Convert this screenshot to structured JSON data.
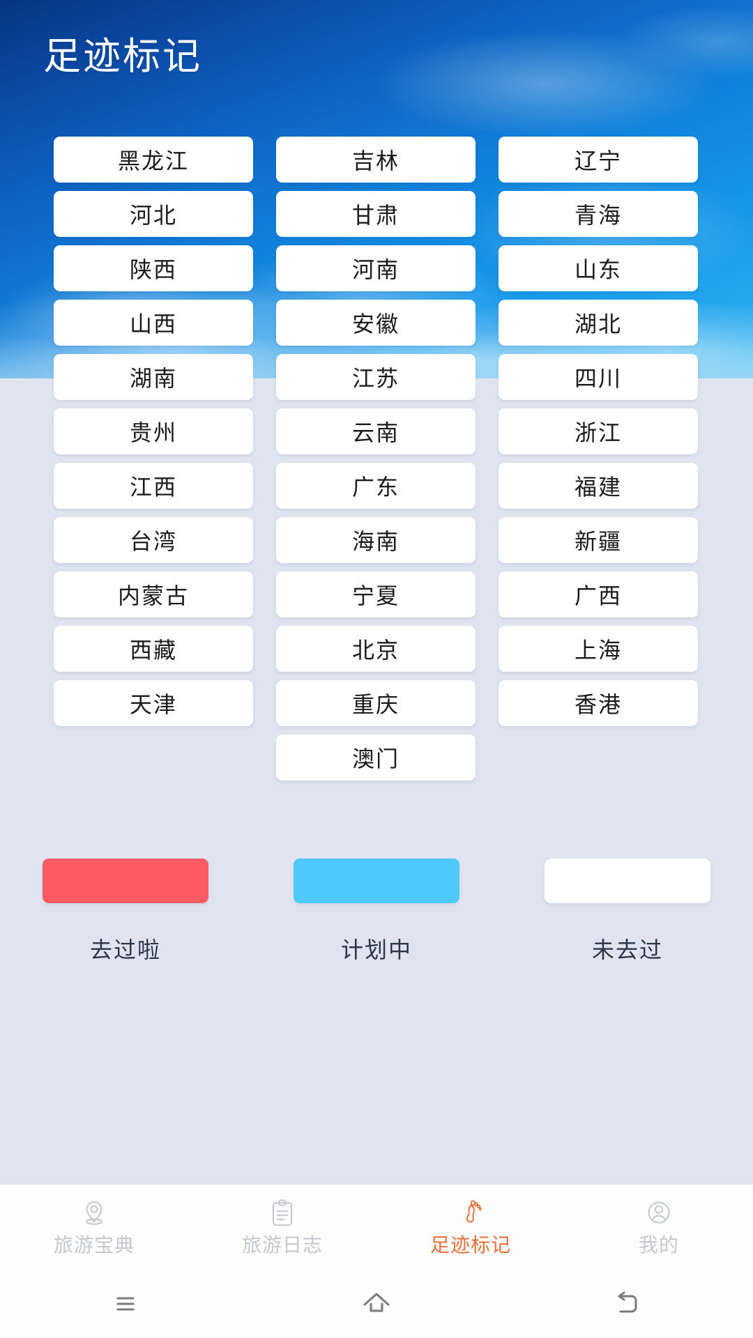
{
  "header": {
    "title": "足迹标记"
  },
  "grid": {
    "provinces": [
      "黑龙江",
      "吉林",
      "辽宁",
      "河北",
      "甘肃",
      "青海",
      "陕西",
      "河南",
      "山东",
      "山西",
      "安徽",
      "湖北",
      "湖南",
      "江苏",
      "四川",
      "贵州",
      "云南",
      "浙江",
      "江西",
      "广东",
      "福建",
      "台湾",
      "海南",
      "新疆",
      "内蒙古",
      "宁夏",
      "广西",
      "西藏",
      "北京",
      "上海",
      "天津",
      "重庆",
      "香港",
      "",
      "澳门",
      ""
    ]
  },
  "legend": {
    "items": [
      {
        "label": "去过啦",
        "color": "#fc5b64"
      },
      {
        "label": "计划中",
        "color": "#4ec9fa"
      },
      {
        "label": "未去过",
        "color": "#ffffff"
      }
    ]
  },
  "tabbar": {
    "items": [
      {
        "label": "旅游宝典",
        "icon": "location-pin-icon",
        "active": false
      },
      {
        "label": "旅游日志",
        "icon": "clipboard-icon",
        "active": false
      },
      {
        "label": "足迹标记",
        "icon": "footprint-icon",
        "active": true
      },
      {
        "label": "我的",
        "icon": "person-icon",
        "active": false
      }
    ],
    "active_color": "#e8703a",
    "inactive_color": "#c5c8cf"
  },
  "sysnav": {
    "items": [
      {
        "name": "recents-button",
        "icon": "hamburger-icon"
      },
      {
        "name": "home-button",
        "icon": "home-icon"
      },
      {
        "name": "back-button",
        "icon": "back-arrow-icon"
      }
    ]
  }
}
